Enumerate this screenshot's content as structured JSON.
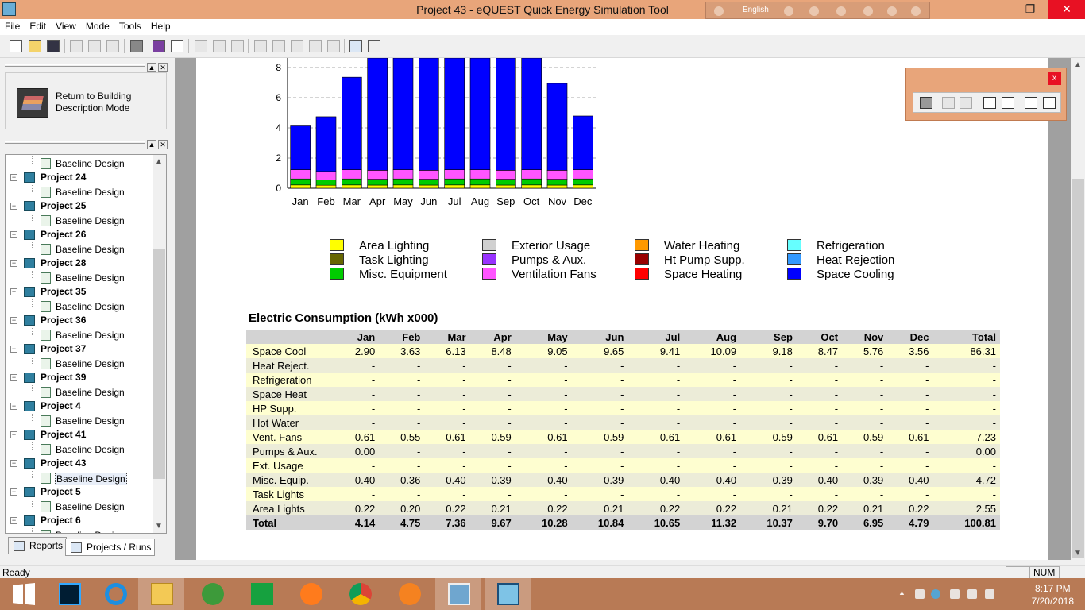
{
  "window": {
    "title": "Project 43 - eQUEST Quick Energy Simulation Tool",
    "language": "English",
    "colors": {
      "titlebar": "#e8a57a",
      "close": "#e81123",
      "taskbar": "#b87a55"
    }
  },
  "menu": [
    "File",
    "Edit",
    "View",
    "Mode",
    "Tools",
    "Help"
  ],
  "toolbar_icons": [
    "new-icon",
    "open-icon",
    "save-icon",
    "cut-icon",
    "copy-icon",
    "paste-icon",
    "print-icon",
    "library-icon",
    "help-icon",
    "wizard-icon",
    "edit-icon",
    "delete-icon",
    "tool-icon",
    "ok-icon",
    "grey-icon",
    "gear-icon",
    "pencil-icon",
    "reports-icon",
    "image-icon"
  ],
  "return_panel": {
    "label": "Return to Building Description Mode"
  },
  "tree": {
    "items": [
      {
        "type": "run",
        "label": "Baseline Design"
      },
      {
        "type": "project",
        "label": "Project 24"
      },
      {
        "type": "run",
        "label": "Baseline Design"
      },
      {
        "type": "project",
        "label": "Project 25"
      },
      {
        "type": "run",
        "label": "Baseline Design"
      },
      {
        "type": "project",
        "label": "Project 26"
      },
      {
        "type": "run",
        "label": "Baseline Design"
      },
      {
        "type": "project",
        "label": "Project 28"
      },
      {
        "type": "run",
        "label": "Baseline Design"
      },
      {
        "type": "project",
        "label": "Project 35"
      },
      {
        "type": "run",
        "label": "Baseline Design"
      },
      {
        "type": "project",
        "label": "Project 36"
      },
      {
        "type": "run",
        "label": "Baseline Design"
      },
      {
        "type": "project",
        "label": "Project 37"
      },
      {
        "type": "run",
        "label": "Baseline Design"
      },
      {
        "type": "project",
        "label": "Project 39"
      },
      {
        "type": "run",
        "label": "Baseline Design"
      },
      {
        "type": "project",
        "label": "Project 4"
      },
      {
        "type": "run",
        "label": "Baseline Design"
      },
      {
        "type": "project",
        "label": "Project 41"
      },
      {
        "type": "run",
        "label": "Baseline Design"
      },
      {
        "type": "project",
        "label": "Project 43"
      },
      {
        "type": "run",
        "label": "Baseline Design",
        "selected": true
      },
      {
        "type": "project",
        "label": "Project 5"
      },
      {
        "type": "run",
        "label": "Baseline Design"
      },
      {
        "type": "project",
        "label": "Project 6"
      },
      {
        "type": "run",
        "label": "Baseline Design"
      }
    ]
  },
  "left_tabs": {
    "reports": "Reports",
    "projects": "Projects / Runs"
  },
  "chart_data": {
    "type": "bar",
    "stacked": true,
    "categories": [
      "Jan",
      "Feb",
      "Mar",
      "Apr",
      "May",
      "Jun",
      "Jul",
      "Aug",
      "Sep",
      "Oct",
      "Nov",
      "Dec"
    ],
    "y_ticks": [
      "0",
      "2",
      "4",
      "6",
      "8"
    ],
    "ylim": [
      0,
      8.2
    ],
    "grid": true,
    "series": [
      {
        "name": "Area Lighting",
        "color": "#ffff00",
        "values": [
          0.22,
          0.2,
          0.22,
          0.21,
          0.22,
          0.21,
          0.22,
          0.22,
          0.21,
          0.22,
          0.21,
          0.22
        ]
      },
      {
        "name": "Misc. Equipment",
        "color": "#00cc00",
        "values": [
          0.4,
          0.36,
          0.4,
          0.39,
          0.4,
          0.39,
          0.4,
          0.4,
          0.39,
          0.4,
          0.39,
          0.4
        ]
      },
      {
        "name": "Ventilation Fans",
        "color": "#ff55ff",
        "values": [
          0.61,
          0.55,
          0.61,
          0.59,
          0.61,
          0.59,
          0.61,
          0.61,
          0.59,
          0.61,
          0.59,
          0.61
        ]
      },
      {
        "name": "Space Cooling",
        "color": "#0000ff",
        "values": [
          2.9,
          3.63,
          6.13,
          8.48,
          9.05,
          9.65,
          9.41,
          10.09,
          9.18,
          8.47,
          5.76,
          3.56
        ]
      }
    ]
  },
  "legend": [
    {
      "label": "Area Lighting",
      "color": "#ffff00"
    },
    {
      "label": "Task Lighting",
      "color": "#666600"
    },
    {
      "label": "Misc. Equipment",
      "color": "#00cc00"
    },
    {
      "label": "Exterior Usage",
      "color": "#d0d0d0"
    },
    {
      "label": "Pumps & Aux.",
      "color": "#9933ff"
    },
    {
      "label": "Ventilation Fans",
      "color": "#ff55ff"
    },
    {
      "label": "Water Heating",
      "color": "#ff9900"
    },
    {
      "label": "Ht Pump Supp.",
      "color": "#990000"
    },
    {
      "label": "Space Heating",
      "color": "#ff0000"
    },
    {
      "label": "Refrigeration",
      "color": "#66ffff"
    },
    {
      "label": "Heat Rejection",
      "color": "#3399ff"
    },
    {
      "label": "Space Cooling",
      "color": "#0000ff"
    }
  ],
  "table": {
    "title": "Electric Consumption (kWh x000)",
    "columns": [
      "",
      "Jan",
      "Feb",
      "Mar",
      "Apr",
      "May",
      "Jun",
      "Jul",
      "Aug",
      "Sep",
      "Oct",
      "Nov",
      "Dec",
      "Total"
    ],
    "rows": [
      [
        "Space Cool",
        "2.90",
        "3.63",
        "6.13",
        "8.48",
        "9.05",
        "9.65",
        "9.41",
        "10.09",
        "9.18",
        "8.47",
        "5.76",
        "3.56",
        "86.31"
      ],
      [
        "Heat Reject.",
        "-",
        "-",
        "-",
        "-",
        "-",
        "-",
        "-",
        "-",
        "-",
        "-",
        "-",
        "-",
        "-"
      ],
      [
        "Refrigeration",
        "-",
        "-",
        "-",
        "-",
        "-",
        "-",
        "-",
        "-",
        "-",
        "-",
        "-",
        "-",
        "-"
      ],
      [
        "Space Heat",
        "-",
        "-",
        "-",
        "-",
        "-",
        "-",
        "-",
        "-",
        "-",
        "-",
        "-",
        "-",
        "-"
      ],
      [
        "HP Supp.",
        "-",
        "-",
        "-",
        "-",
        "-",
        "-",
        "-",
        "-",
        "-",
        "-",
        "-",
        "-",
        "-"
      ],
      [
        "Hot Water",
        "-",
        "-",
        "-",
        "-",
        "-",
        "-",
        "-",
        "-",
        "-",
        "-",
        "-",
        "-",
        "-"
      ],
      [
        "Vent. Fans",
        "0.61",
        "0.55",
        "0.61",
        "0.59",
        "0.61",
        "0.59",
        "0.61",
        "0.61",
        "0.59",
        "0.61",
        "0.59",
        "0.61",
        "7.23"
      ],
      [
        "Pumps & Aux.",
        "0.00",
        "-",
        "-",
        "-",
        "-",
        "-",
        "-",
        "-",
        "-",
        "-",
        "-",
        "-",
        "0.00"
      ],
      [
        "Ext. Usage",
        "-",
        "-",
        "-",
        "-",
        "-",
        "-",
        "-",
        "-",
        "-",
        "-",
        "-",
        "-",
        "-"
      ],
      [
        "Misc. Equip.",
        "0.40",
        "0.36",
        "0.40",
        "0.39",
        "0.40",
        "0.39",
        "0.40",
        "0.40",
        "0.39",
        "0.40",
        "0.39",
        "0.40",
        "4.72"
      ],
      [
        "Task Lights",
        "-",
        "-",
        "-",
        "-",
        "-",
        "-",
        "-",
        "-",
        "-",
        "-",
        "-",
        "-",
        "-"
      ],
      [
        "Area Lights",
        "0.22",
        "0.20",
        "0.22",
        "0.21",
        "0.22",
        "0.21",
        "0.22",
        "0.22",
        "0.21",
        "0.22",
        "0.21",
        "0.22",
        "2.55"
      ]
    ],
    "total": [
      "Total",
      "4.14",
      "4.75",
      "7.36",
      "9.67",
      "10.28",
      "10.84",
      "10.65",
      "11.32",
      "10.37",
      "9.70",
      "6.95",
      "4.79",
      "100.81"
    ]
  },
  "status": {
    "text": "Ready",
    "num": "NUM"
  },
  "clock": {
    "time": "8:17 PM",
    "date": "7/20/2018"
  },
  "taskbar_apps": [
    "windows-start-icon",
    "photoshop-icon",
    "internet-explorer-icon",
    "file-explorer-icon",
    "globe-icon",
    "store-icon",
    "firefox-icon",
    "chrome-beta-icon",
    "uc-browser-icon",
    "photos-icon",
    "equest-icon"
  ]
}
